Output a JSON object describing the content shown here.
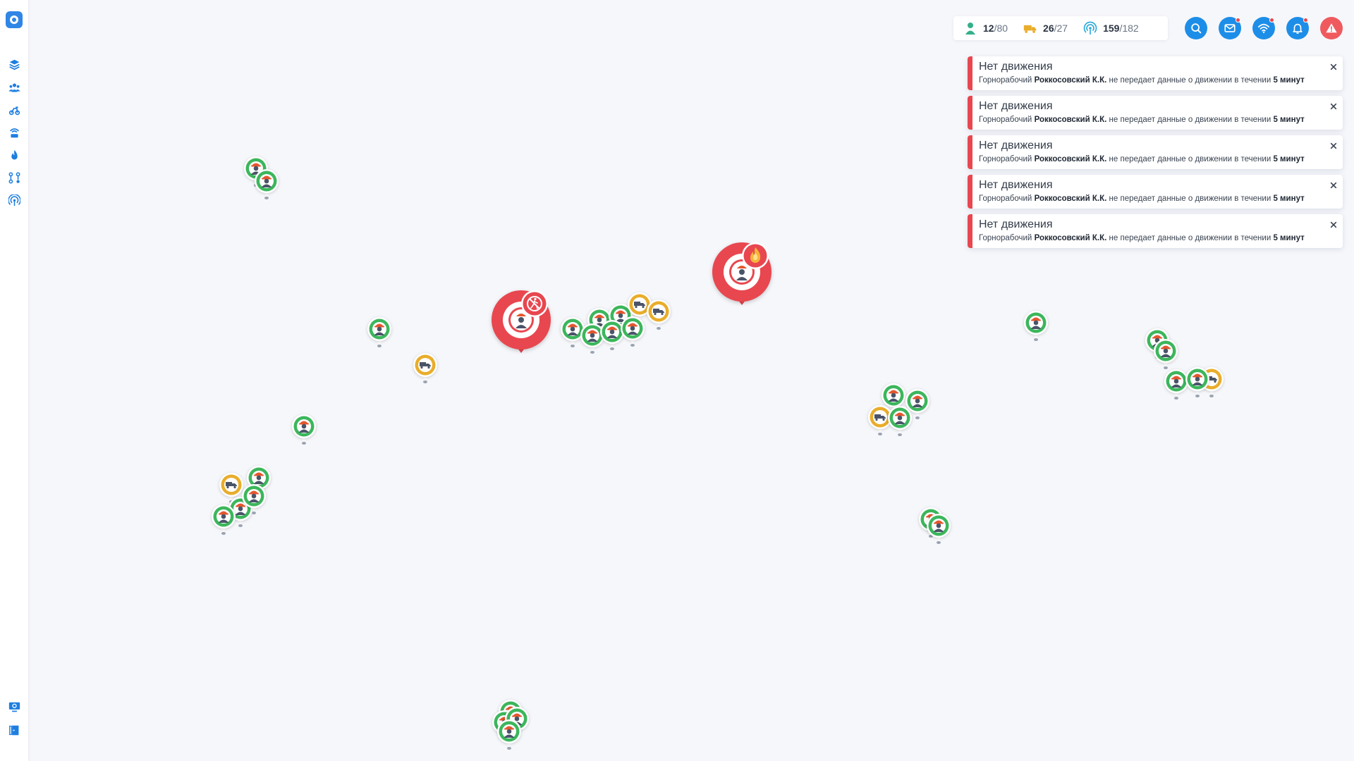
{
  "colors": {
    "accent": "#1d8ee8",
    "alert": "#e8474f",
    "worker_marker": "#3cb65c",
    "vehicle_marker": "#e9ad2b",
    "background": "#f6f7fb"
  },
  "sidebar": {
    "logo_icon": "app-logo-icon",
    "items": [
      {
        "name": "layers",
        "icon": "layers-icon"
      },
      {
        "name": "workers",
        "icon": "group-icon"
      },
      {
        "name": "vehicles",
        "icon": "vehicles-icon"
      },
      {
        "name": "access-points",
        "icon": "router-icon"
      },
      {
        "name": "fire",
        "icon": "fire-icon"
      },
      {
        "name": "routes",
        "icon": "route-icon"
      },
      {
        "name": "signals",
        "icon": "broadcast-icon"
      }
    ],
    "bottom": [
      {
        "name": "monitor",
        "icon": "monitor-icon"
      },
      {
        "name": "exit",
        "icon": "exit-door-icon"
      }
    ]
  },
  "stats": {
    "workers": {
      "current": "12",
      "separator": "/",
      "total": "80",
      "icon": "worker-icon"
    },
    "vehicles": {
      "current": "26",
      "separator": "/",
      "total": "27",
      "icon": "truck-icon"
    },
    "beacons": {
      "current": "159",
      "separator": "/",
      "total": "182",
      "icon": "broadcast-icon"
    }
  },
  "header_buttons": [
    {
      "name": "search",
      "icon": "search-icon",
      "badge": false
    },
    {
      "name": "messages",
      "icon": "mail-icon",
      "badge": true
    },
    {
      "name": "network",
      "icon": "wifi-icon",
      "badge": true
    },
    {
      "name": "notifications",
      "icon": "bell-icon",
      "badge": true
    },
    {
      "name": "alarm",
      "icon": "warning-icon",
      "badge": false
    }
  ],
  "notifications": [
    {
      "title": "Нет движения",
      "prefix": "Горнорабочий",
      "person": "Роккосовский К.К.",
      "middle": "не передает данные о движении в течении",
      "duration": "5 минут"
    },
    {
      "title": "Нет движения",
      "prefix": "Горнорабочий",
      "person": "Роккосовский К.К.",
      "middle": "не передает данные о движении в течении",
      "duration": "5 минут"
    },
    {
      "title": "Нет движения",
      "prefix": "Горнорабочий",
      "person": "Роккосовский К.К.",
      "middle": "не передает данные о движении в течении",
      "duration": "5 минут"
    },
    {
      "title": "Нет движения",
      "prefix": "Горнорабочий",
      "person": "Роккосовский К.К.",
      "middle": "не передает данные о движении в течении",
      "duration": "5 минут"
    },
    {
      "title": "Нет движения",
      "prefix": "Горнорабочий",
      "person": "Роккосовский К.К.",
      "middle": "не передает данные о движении в течении",
      "duration": "5 минут"
    }
  ],
  "map": {
    "alerts": [
      {
        "type": "no-movement",
        "icon": "no-walking-icon"
      },
      {
        "type": "fire",
        "icon": "fire-icon"
      }
    ],
    "worker_marker_icon": "worker-icon",
    "vehicle_marker_icon": "truck-icon"
  }
}
